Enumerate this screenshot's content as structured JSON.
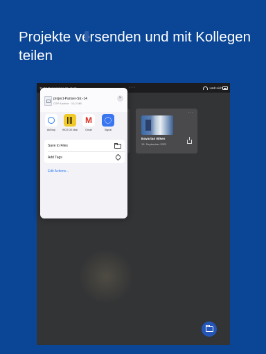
{
  "headline": "Projekte versenden und mit Kollegen teilen",
  "status_bar": {
    "time": "11:42",
    "date": "Donnerstag 15. Sept.",
    "signal": "Lädt nicht"
  },
  "project_card": {
    "title": "Bavarian Bikes",
    "date": "15. September 2022",
    "menu": "···"
  },
  "share_sheet": {
    "file_name": "project-Pariser-Str.-14",
    "file_meta": "CSP Archive · 10,2 MB",
    "close": "×",
    "apps": [
      {
        "label": "AirDrop",
        "icon": "airdrop-icon"
      },
      {
        "label": "WCS DE Mail",
        "icon": "wcs-icon"
      },
      {
        "label": "Gmail",
        "icon": "gmail-icon"
      },
      {
        "label": "Signal",
        "icon": "signal-icon"
      }
    ],
    "actions": [
      {
        "label": "Save to Files",
        "icon": "folder-icon"
      },
      {
        "label": "Add Tags",
        "icon": "tag-icon"
      }
    ],
    "edit_actions": "Edit Actions..."
  },
  "gmail_letter": "M",
  "colors": {
    "background": "#0a4596",
    "tablet": "#333436",
    "fab": "#2455b7",
    "link": "#2f7bf5"
  }
}
